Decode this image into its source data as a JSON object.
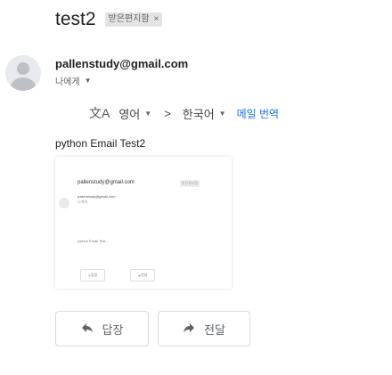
{
  "header": {
    "subject": "test2",
    "label": "받은편지함",
    "label_close": "×"
  },
  "message": {
    "sender": "pallenstudy@gmail.com",
    "to_me": "나에게",
    "body": "python Email Test2"
  },
  "translate": {
    "from_lang": "영어",
    "arrow": ">",
    "to_lang": "한국어",
    "action": "메일 번역"
  },
  "preview": {
    "sender": "pallenstudy@gmail.com",
    "label": "받은편지함",
    "line1": "pallenstudy@gmail.com",
    "line2": "나에게",
    "body": "python Email Test",
    "reply": "답장",
    "forward": "전달"
  },
  "actions": {
    "reply": "답장",
    "forward": "전달"
  },
  "icons": {
    "translate": "translate-icon",
    "reply": "reply-icon",
    "forward": "forward-icon",
    "avatar": "avatar-icon"
  }
}
